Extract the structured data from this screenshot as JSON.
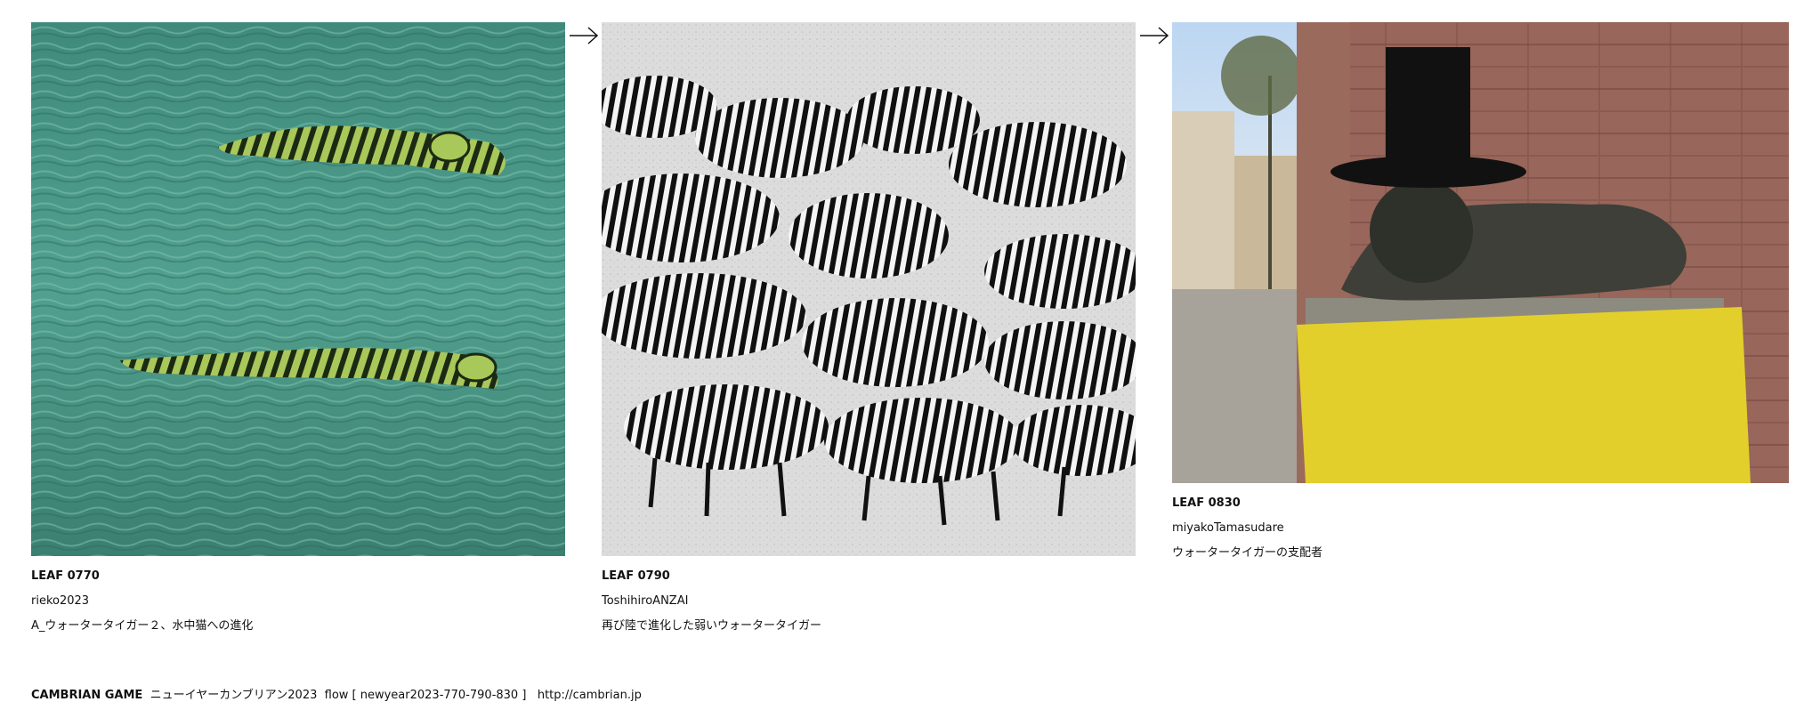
{
  "leaves": [
    {
      "code": "LEAF 0770",
      "author": "rieko2023",
      "title": "A_ウォータータイガー２、水中猫への進化"
    },
    {
      "code": "LEAF 0790",
      "author": "ToshihiroANZAI",
      "title": "再び陸で進化した弱いウォータータイガー"
    },
    {
      "code": "LEAF 0830",
      "author": "miyakoTamasudare",
      "title": "ウォータータイガーの支配者"
    }
  ],
  "footer": {
    "brand": "CAMBRIAN GAME",
    "flow_text": "ニューイヤーカンブリアン2023  flow [ newyear2023-770-790-830 ]",
    "url": "http://cambrian.jp"
  },
  "icons": {
    "flow_arrow": "right-arrow-icon"
  },
  "colors": {
    "sea": "#4a9485",
    "sand": "#dcdcdc",
    "wall": "#8a5a4e",
    "yellow_pedestal": "#e2cf2c"
  }
}
